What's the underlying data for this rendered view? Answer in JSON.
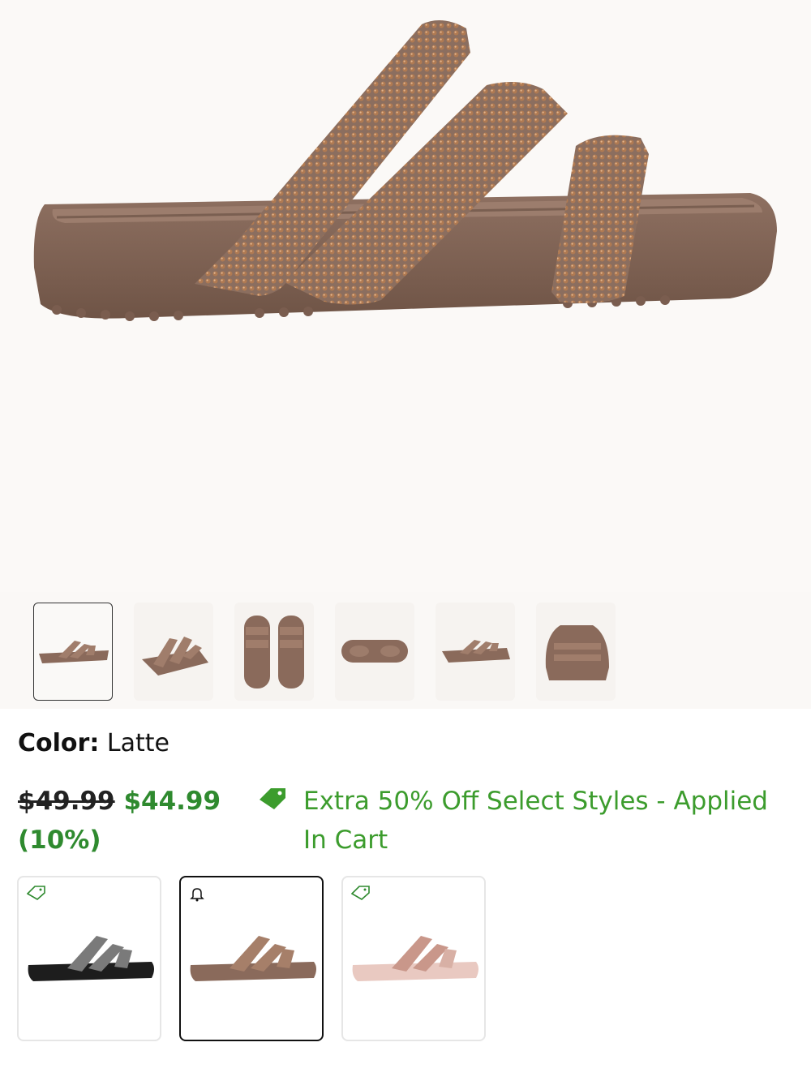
{
  "product": {
    "image_name": "sandal-latte-side-view",
    "selected_thumbnail": 0
  },
  "thumbnails": [
    {
      "name": "thumbnail-side"
    },
    {
      "name": "thumbnail-angle"
    },
    {
      "name": "thumbnail-top"
    },
    {
      "name": "thumbnail-sole"
    },
    {
      "name": "thumbnail-pair-side"
    },
    {
      "name": "thumbnail-back"
    }
  ],
  "color": {
    "label": "Color:",
    "value": "Latte"
  },
  "price": {
    "original": "$49.99",
    "sale": "$44.99",
    "discount": "(10%)"
  },
  "promo": {
    "icon": "tag-icon",
    "text": "Extra 50% Off Select Styles - Applied In Cart",
    "color": "#3c9c2d"
  },
  "variants": [
    {
      "name": "Black",
      "icon": "tag-icon",
      "selected": false
    },
    {
      "name": "Latte",
      "icon": "bell-icon",
      "selected": true
    },
    {
      "name": "Pink",
      "icon": "tag-icon",
      "selected": false
    }
  ],
  "colors": {
    "accent_green": "#2f8a2f",
    "sandal_latte": "#8a6a5b"
  }
}
